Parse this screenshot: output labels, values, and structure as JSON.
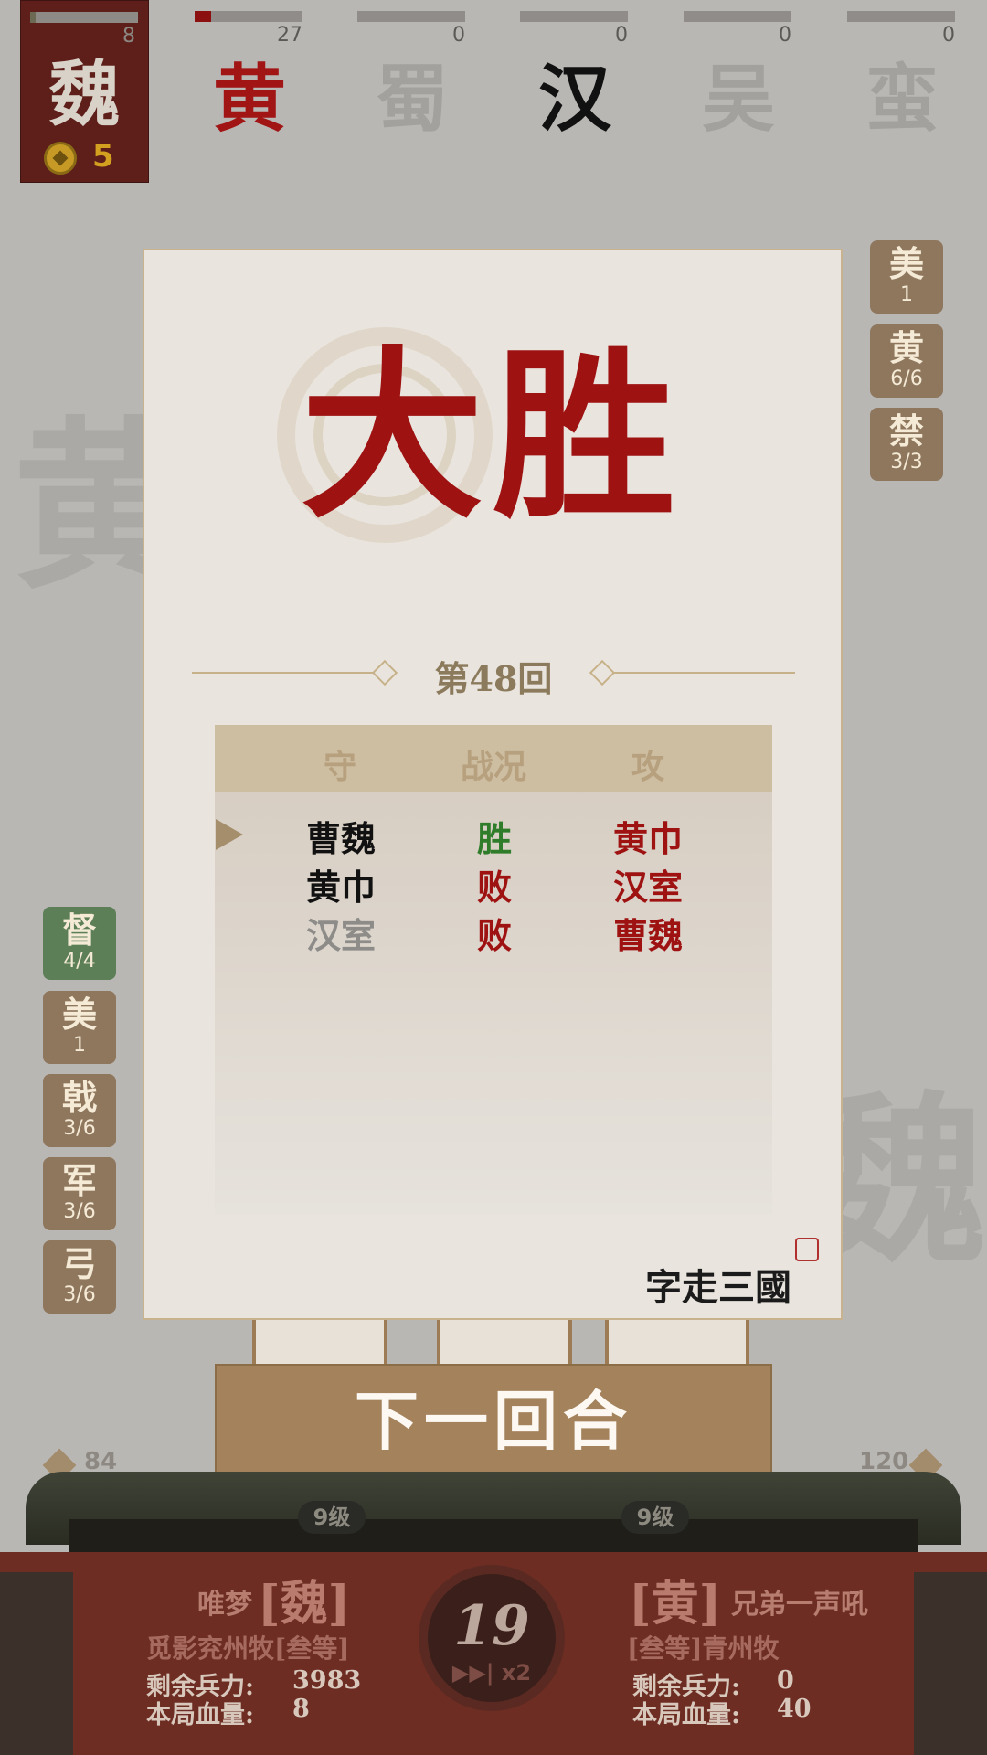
{
  "player_card": {
    "char": "魏",
    "count": "8",
    "gold": "5",
    "hp_fraction": 0.05
  },
  "factions": [
    {
      "char": "黄",
      "count": "27",
      "fill": 0.15,
      "color": "#a11515"
    },
    {
      "char": "蜀",
      "count": "0",
      "fill": 0,
      "color": "#a3a19e"
    },
    {
      "char": "汉",
      "count": "0",
      "fill": 0,
      "color": "#111111"
    },
    {
      "char": "吴",
      "count": "0",
      "fill": 0,
      "color": "#a3a19e"
    },
    {
      "char": "蛮",
      "count": "0",
      "fill": 0,
      "color": "#a3a19e"
    }
  ],
  "bg_chars": {
    "left": "黄",
    "right": "魏"
  },
  "right_tags": [
    {
      "title": "美",
      "sub": "1"
    },
    {
      "title": "黄",
      "sub": "6/6"
    },
    {
      "title": "禁",
      "sub": "3/3"
    }
  ],
  "left_tags": [
    {
      "title": "督",
      "sub": "4/4",
      "style": "green"
    },
    {
      "title": "美",
      "sub": "1"
    },
    {
      "title": "戟",
      "sub": "3/6"
    },
    {
      "title": "军",
      "sub": "3/6"
    },
    {
      "title": "弓",
      "sub": "3/6"
    }
  ],
  "dialog": {
    "victory_text": "大胜",
    "round_label": "第48回",
    "headers": {
      "defend": "守",
      "status": "战况",
      "attack": "攻"
    },
    "rows": [
      {
        "defend": "曹魏",
        "status": "胜",
        "attack": "黄巾",
        "defend_color": "#111111",
        "status_color": "#2f7d2a",
        "attack_color": "#9e1212"
      },
      {
        "defend": "黄巾",
        "status": "败",
        "attack": "汉室",
        "defend_color": "#111111",
        "status_color": "#9e1212",
        "attack_color": "#9e1212"
      },
      {
        "defend": "汉室",
        "status": "败",
        "attack": "曹魏",
        "defend_color": "#8e8c89",
        "status_color": "#9e1212",
        "attack_color": "#9e1212"
      }
    ],
    "signature": "字走三國"
  },
  "next_button": "下一回合",
  "bottom_left_num": "84",
  "bottom_right_num": "120",
  "levels": {
    "left": "9级",
    "right": "9级"
  },
  "left_player": {
    "name": "唯梦",
    "faction": "[魏]",
    "title": "觅影兖州牧[叁等]",
    "troops_label": "剩余兵力:",
    "troops": "3983",
    "hp_label": "本局血量:",
    "hp": "8"
  },
  "right_player": {
    "faction": "[黄]",
    "name": "兄弟一声吼",
    "title": "[叁等]青州牧",
    "troops_label": "剩余兵力:",
    "troops": "0",
    "hp_label": "本局血量:",
    "hp": "40"
  },
  "timer": "19",
  "speed": "▶▶| x2",
  "colors": {
    "accent_red": "#9e1212",
    "panel": "#6d2d23",
    "tag": "#8f775e",
    "button": "#a3825c"
  }
}
